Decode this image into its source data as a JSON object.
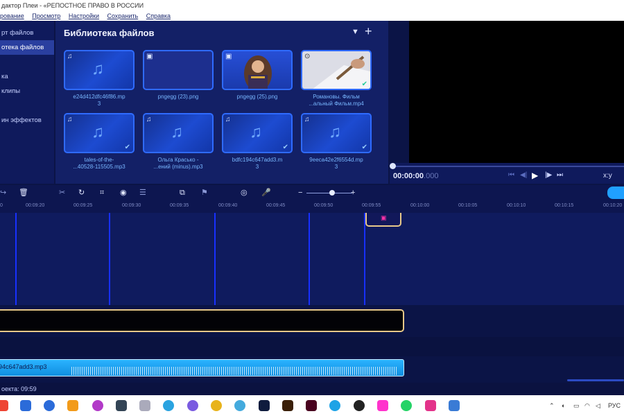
{
  "window": {
    "title": "дактор Плеи - «РЕПОСТНОЕ ПРАВО В РОССИИ"
  },
  "menu": [
    "рование",
    "Просмотр",
    "Настройки",
    "Сохранить",
    "Справка"
  ],
  "sidebar": {
    "items": [
      "рт файлов",
      "отека файлов",
      "",
      "ка",
      "клипы",
      "",
      "ин эффектов"
    ]
  },
  "library": {
    "title": "Библиотека файлов",
    "files": [
      {
        "line1": "e24d412dfc46f86.mp",
        "line2": "3",
        "icon": "music-note-icon",
        "checked": false
      },
      {
        "line1": "pngegg (23).png",
        "line2": "",
        "icon": "image-icon",
        "checked": false
      },
      {
        "line1": "pngegg (25).png",
        "line2": "",
        "icon": "image-icon",
        "checked": false
      },
      {
        "line1": "Романовы. Фильм",
        "line2": "...альный Фильм.mp4",
        "icon": "video-icon",
        "checked": true
      },
      {
        "line1": "tales-of-the-",
        "line2": "...40528-115505.mp3",
        "icon": "music-note-icon",
        "checked": true
      },
      {
        "line1": "Ольга Красько -",
        "line2": "...ений (minus).mp3",
        "icon": "music-note-icon",
        "checked": false
      },
      {
        "line1": "bdfc194c647add3.m",
        "line2": "3",
        "icon": "music-note-icon",
        "checked": true
      },
      {
        "line1": "9eeca42e2f6554d.mp",
        "line2": "3",
        "icon": "music-note-icon",
        "checked": true
      }
    ]
  },
  "player": {
    "time": "00:00:00",
    "time_ms": ".000",
    "ratio": "х:у"
  },
  "ruler": {
    "ticks": [
      "0",
      "00:09:20",
      "00:09:25",
      "00:09:30",
      "00:09:35",
      "00:09:40",
      "00:09:45",
      "00:09:50",
      "00:09:55",
      "00:10:00",
      "00:10:05",
      "00:10:10",
      "00:10:15",
      "00:10:20"
    ]
  },
  "timeline": {
    "audio_clip_label": "94c647add3.mp3"
  },
  "status": {
    "duration": "оекта: 09:59"
  },
  "tray": {
    "lang": "РУС"
  },
  "colors": {
    "accent": "#2f6bff",
    "clip_border": "#e7c889",
    "audio": "#1aa5ff",
    "marker": "#1730ff"
  }
}
